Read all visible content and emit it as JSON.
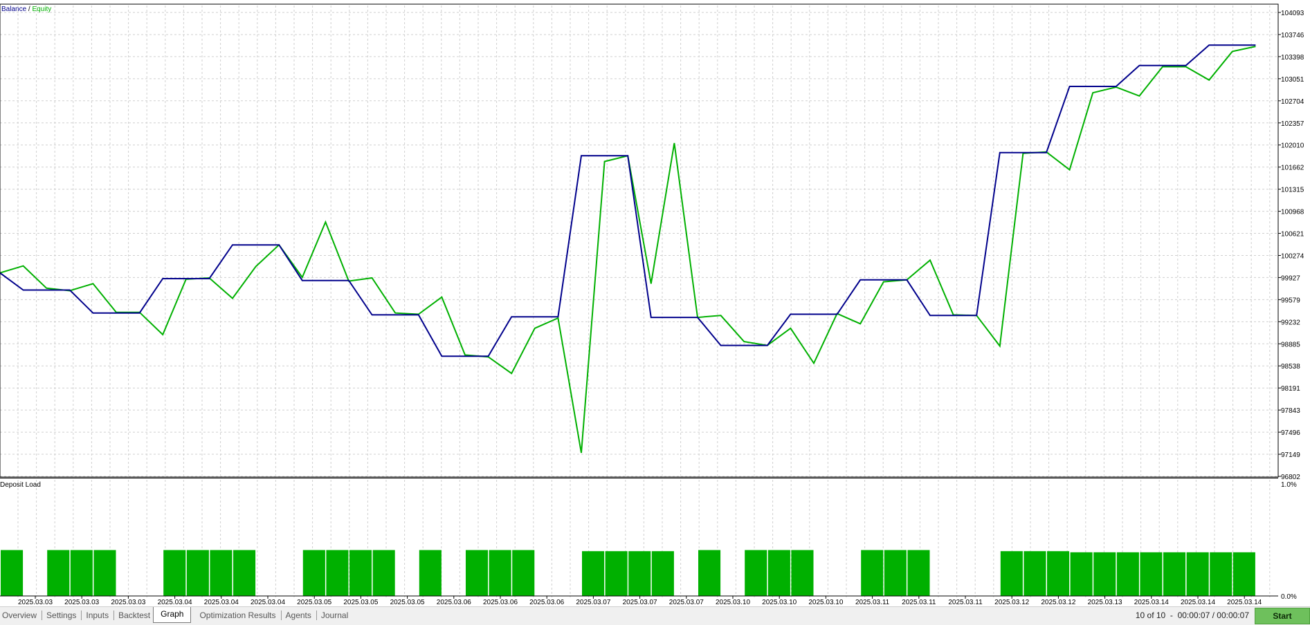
{
  "main_chart": {
    "legend": {
      "balance_label": "Balance",
      "separator": " / ",
      "equity_label": "Equity"
    },
    "colors": {
      "balance": "#00008b",
      "equity": "#00b000",
      "deposit_bars": "#00b000",
      "grid": "#cfcfcf"
    }
  },
  "chart_data": [
    {
      "type": "line",
      "title": "",
      "xlabel": "",
      "ylabel": "",
      "ylim": [
        96802,
        104093
      ],
      "y_ticks": [
        "104093",
        "103746",
        "103398",
        "103051",
        "102704",
        "102357",
        "102010",
        "101662",
        "101315",
        "100968",
        "100621",
        "100274",
        "99927",
        "99579",
        "99232",
        "98885",
        "98538",
        "98191",
        "97843",
        "97496",
        "97149",
        "96802"
      ],
      "x_tick_labels": [
        "2025.03.03",
        "2025.03.03",
        "2025.03.03",
        "2025.03.04",
        "2025.03.04",
        "2025.03.04",
        "2025.03.05",
        "2025.03.05",
        "2025.03.05",
        "2025.03.06",
        "2025.03.06",
        "2025.03.06",
        "2025.03.07",
        "2025.03.07",
        "2025.03.07",
        "2025.03.10",
        "2025.03.10",
        "2025.03.10",
        "2025.03.11",
        "2025.03.11",
        "2025.03.11",
        "2025.03.12",
        "2025.03.12",
        "2025.03.13",
        "2025.03.14",
        "2025.03.14",
        "2025.03.14"
      ],
      "x": [
        0,
        1,
        2,
        3,
        4,
        5,
        6,
        7,
        8,
        9,
        10,
        11,
        12,
        13,
        14,
        15,
        16,
        17,
        18,
        19,
        20,
        21,
        22,
        23,
        24,
        25,
        26,
        27,
        28,
        29,
        30,
        31,
        32,
        33,
        34,
        35,
        36,
        37,
        38,
        39,
        40,
        41,
        42,
        43,
        44,
        45,
        46,
        47,
        48,
        49,
        50,
        51,
        52,
        53,
        54
      ],
      "series": [
        {
          "name": "Balance",
          "color": "#00008b",
          "values": [
            100000,
            99730,
            99730,
            99730,
            99370,
            99370,
            99370,
            99910,
            99910,
            99910,
            100440,
            100440,
            100440,
            99880,
            99880,
            99880,
            99340,
            99340,
            99340,
            98690,
            98690,
            98690,
            99310,
            99310,
            99310,
            101840,
            101840,
            101840,
            99300,
            99300,
            99300,
            98860,
            98860,
            98860,
            99350,
            99350,
            99350,
            99890,
            99890,
            99890,
            99330,
            99330,
            99330,
            101890,
            101890,
            101890,
            102930,
            102930,
            102930,
            103260,
            103260,
            103260,
            103580,
            103580,
            103580
          ]
        },
        {
          "name": "Equity",
          "color": "#00b000",
          "values": [
            100000,
            100110,
            99760,
            99720,
            99830,
            99380,
            99380,
            99030,
            99900,
            99920,
            99600,
            100100,
            100440,
            99930,
            100800,
            99870,
            99920,
            99370,
            99350,
            99620,
            98710,
            98680,
            98420,
            99130,
            99290,
            97170,
            101750,
            101840,
            99830,
            102040,
            99300,
            99330,
            98920,
            98860,
            99130,
            98580,
            99360,
            99200,
            99860,
            99890,
            100200,
            99340,
            99330,
            98850,
            101880,
            101900,
            101620,
            102830,
            102920,
            102780,
            103240,
            103240,
            103030,
            103480,
            103560
          ]
        }
      ]
    },
    {
      "type": "bar",
      "title": "Deposit Load",
      "ylim": [
        0.0,
        1.0
      ],
      "y_tick_labels": [
        "1.0%",
        "0.0%"
      ],
      "categories": [
        0,
        1,
        2,
        3,
        4,
        5,
        6,
        7,
        8,
        9,
        10,
        11,
        12,
        13,
        14,
        15,
        16,
        17,
        18,
        19,
        20,
        21,
        22,
        23,
        24,
        25,
        26,
        27,
        28,
        29,
        30,
        31,
        32,
        33,
        34,
        35,
        36,
        37,
        38,
        39,
        40,
        41,
        42,
        43,
        44,
        45,
        46,
        47,
        48,
        49,
        50,
        51,
        52,
        53,
        54
      ],
      "values": [
        0,
        0.41,
        0,
        0.41,
        0.41,
        0.41,
        0,
        0,
        0.41,
        0.41,
        0.41,
        0.41,
        0,
        0,
        0.41,
        0.41,
        0.41,
        0.41,
        0,
        0.41,
        0,
        0.41,
        0.41,
        0.41,
        0,
        0,
        0.4,
        0.4,
        0.4,
        0.4,
        0,
        0.41,
        0,
        0.41,
        0.41,
        0.41,
        0,
        0,
        0.41,
        0.41,
        0.41,
        0,
        0,
        0,
        0.4,
        0.4,
        0.4,
        0.39,
        0.39,
        0.39,
        0.39,
        0.39,
        0.39,
        0.39,
        0.39
      ]
    }
  ],
  "bottom_bar": {
    "tabs": [
      {
        "label": "Overview",
        "active": false
      },
      {
        "label": "Settings",
        "active": false
      },
      {
        "label": "Inputs",
        "active": false
      },
      {
        "label": "Backtest",
        "active": false
      },
      {
        "label": "Graph",
        "active": true
      },
      {
        "label": "Optimization Results",
        "active": false
      },
      {
        "label": "Agents",
        "active": false
      },
      {
        "label": "Journal",
        "active": false
      }
    ],
    "status": "10 of 10  -  00:00:07 / 00:00:07",
    "start_label": "Start"
  }
}
